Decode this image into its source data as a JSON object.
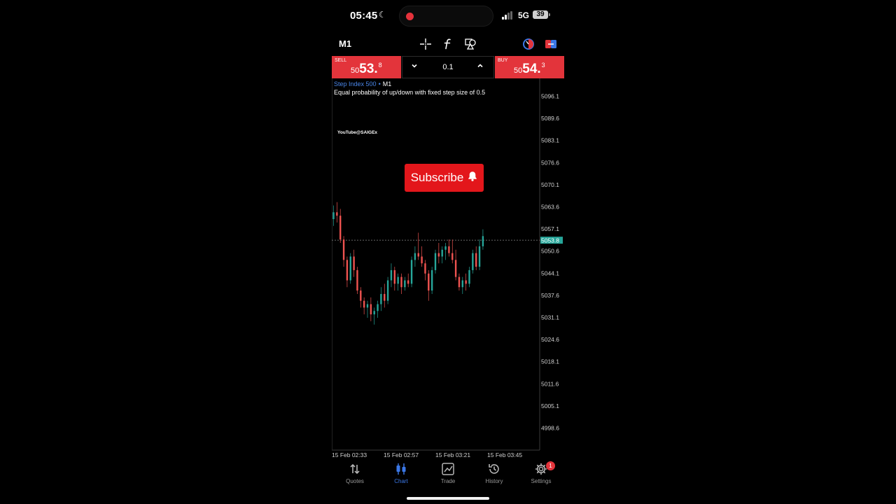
{
  "status": {
    "time": "05:45",
    "network": "5G",
    "battery": "39"
  },
  "toolbar": {
    "timeframe": "M1",
    "icons": [
      "crosshair-icon",
      "function-icon",
      "shapes-icon",
      "one-click-trading-icon",
      "trade-panel-icon"
    ]
  },
  "trade": {
    "sell_label": "SELL",
    "sell_small": "50",
    "sell_big": "53.",
    "sell_sup": "8",
    "buy_label": "BUY",
    "buy_small": "50",
    "buy_big": "54.",
    "buy_sup": "3",
    "volume": "0.1"
  },
  "chart": {
    "symbol": "Step Index 500",
    "separator": "•",
    "timeframe": "M1",
    "description": "Equal probability of up/down with fixed step size of 0.5",
    "watermark": "YouTube@SAIGEx",
    "subscribe_label": "Subscribe",
    "current_price": "5053.8"
  },
  "colors": {
    "accent": "#3b78e7",
    "sell_buy": "#e3343b",
    "up": "#26a69a",
    "down": "#ef5350",
    "subscribe": "#e3161b"
  },
  "chart_data": {
    "type": "candlestick",
    "y_ticks": [
      "5096.1",
      "5089.6",
      "5083.1",
      "5076.6",
      "5070.1",
      "5063.6",
      "5057.1",
      "5050.6",
      "5044.1",
      "5037.6",
      "5031.1",
      "5024.6",
      "5018.1",
      "5011.6",
      "5005.1",
      "4998.6"
    ],
    "x_ticks": [
      "15 Feb 02:33",
      "15 Feb 02:57",
      "15 Feb 03:21",
      "15 Feb 03:45"
    ],
    "current_price": 5053.8,
    "ohlc": [
      [
        5060,
        5064,
        5058,
        5062
      ],
      [
        5062,
        5065,
        5059,
        5061
      ],
      [
        5061,
        5063,
        5053,
        5054
      ],
      [
        5054,
        5055,
        5046,
        5048
      ],
      [
        5048,
        5049,
        5040,
        5042
      ],
      [
        5042,
        5050,
        5041,
        5049
      ],
      [
        5049,
        5051,
        5043,
        5045
      ],
      [
        5045,
        5046,
        5038,
        5039
      ],
      [
        5039,
        5040,
        5034,
        5036
      ],
      [
        5036,
        5037,
        5032,
        5034
      ],
      [
        5034,
        5036,
        5031,
        5035
      ],
      [
        5035,
        5037,
        5030,
        5032
      ],
      [
        5032,
        5034,
        5029,
        5033
      ],
      [
        5033,
        5036,
        5031,
        5035
      ],
      [
        5035,
        5040,
        5033,
        5038
      ],
      [
        5038,
        5041,
        5034,
        5036
      ],
      [
        5036,
        5043,
        5035,
        5042
      ],
      [
        5042,
        5047,
        5040,
        5045
      ],
      [
        5045,
        5046,
        5039,
        5041
      ],
      [
        5041,
        5044,
        5039,
        5043
      ],
      [
        5043,
        5044,
        5038,
        5040
      ],
      [
        5040,
        5043,
        5039,
        5042
      ],
      [
        5042,
        5044,
        5040,
        5041
      ],
      [
        5041,
        5049,
        5040,
        5048
      ],
      [
        5048,
        5052,
        5046,
        5050
      ],
      [
        5050,
        5056,
        5048,
        5049
      ],
      [
        5049,
        5052,
        5046,
        5047
      ],
      [
        5047,
        5048,
        5042,
        5044
      ],
      [
        5044,
        5045,
        5036,
        5039
      ],
      [
        5039,
        5046,
        5038,
        5045
      ],
      [
        5045,
        5051,
        5044,
        5050
      ],
      [
        5050,
        5053,
        5047,
        5049
      ],
      [
        5049,
        5052,
        5047,
        5051
      ],
      [
        5051,
        5053,
        5048,
        5052
      ],
      [
        5052,
        5054,
        5049,
        5050
      ],
      [
        5050,
        5054,
        5047,
        5048
      ],
      [
        5048,
        5051,
        5042,
        5043
      ],
      [
        5043,
        5044,
        5039,
        5040
      ],
      [
        5040,
        5043,
        5038,
        5042
      ],
      [
        5042,
        5044,
        5039,
        5041
      ],
      [
        5041,
        5046,
        5040,
        5045
      ],
      [
        5045,
        5051,
        5044,
        5050
      ],
      [
        5050,
        5052,
        5045,
        5046
      ],
      [
        5046,
        5054,
        5045,
        5052
      ],
      [
        5052,
        5057,
        5051,
        5055
      ]
    ]
  },
  "tabs": [
    {
      "label": "Quotes",
      "icon": "quotes-icon",
      "active": false
    },
    {
      "label": "Chart",
      "icon": "chart-icon",
      "active": true
    },
    {
      "label": "Trade",
      "icon": "trade-icon",
      "active": false
    },
    {
      "label": "History",
      "icon": "history-icon",
      "active": false
    },
    {
      "label": "Settings",
      "icon": "settings-icon",
      "active": false
    }
  ],
  "settings_badge": "1"
}
